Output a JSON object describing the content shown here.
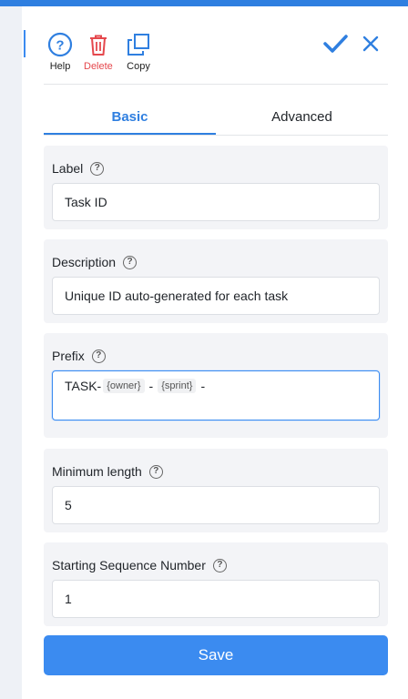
{
  "toolbar": {
    "help_label": "Help",
    "delete_label": "Delete",
    "copy_label": "Copy"
  },
  "tabs": [
    {
      "label": "Basic",
      "active": true
    },
    {
      "label": "Advanced",
      "active": false
    }
  ],
  "fields": {
    "label": {
      "title": "Label",
      "value": "Task ID"
    },
    "description": {
      "title": "Description",
      "value": "Unique ID auto-generated for each task"
    },
    "prefix": {
      "title": "Prefix",
      "text": "TASK-",
      "tokens": [
        "{owner}",
        "{sprint}"
      ],
      "separator": "-"
    },
    "min_length": {
      "title": "Minimum length",
      "value": "5"
    },
    "start_seq": {
      "title": "Starting Sequence Number",
      "value": "1"
    }
  },
  "help_glyph": "?",
  "save_label": "Save",
  "colors": {
    "accent": "#2f7fe0",
    "delete": "#e5484d",
    "save_bg": "#3b8bf0"
  }
}
